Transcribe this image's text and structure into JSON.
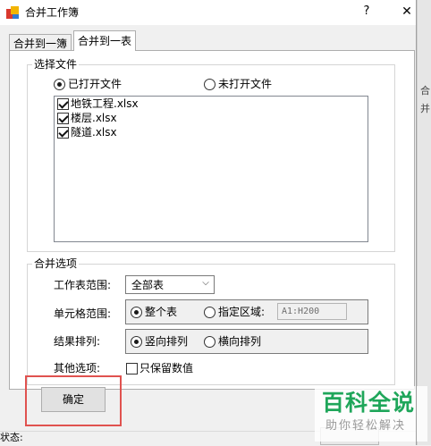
{
  "window": {
    "title": "合并工作簿",
    "help_label": "?",
    "close_label": "✕"
  },
  "tabs": [
    {
      "label": "合并到一簿",
      "selected": false
    },
    {
      "label": "合并到一表",
      "selected": true
    }
  ],
  "file_group": {
    "legend": "选择文件",
    "radio_opened": {
      "label": "已打开文件",
      "checked": true
    },
    "radio_unopened": {
      "label": "未打开文件",
      "checked": false
    },
    "files": [
      {
        "label": "地铁工程.xlsx",
        "checked": true
      },
      {
        "label": "楼层.xlsx",
        "checked": true
      },
      {
        "label": "隧道.xlsx",
        "checked": true
      }
    ]
  },
  "merge_group": {
    "legend": "合并选项",
    "sheet_range": {
      "label": "工作表范围:",
      "value": "全部表",
      "arrow_icon": "chevron-down-icon"
    },
    "cell_range": {
      "label": "单元格范围:",
      "opt_whole": {
        "label": "整个表",
        "checked": true
      },
      "opt_specified": {
        "label": "指定区域:",
        "checked": false
      },
      "range_value": "A1:H200"
    },
    "result_order": {
      "label": "结果排列:",
      "opt_vertical": {
        "label": "竖向排列",
        "checked": true
      },
      "opt_horizontal": {
        "label": "横向排列",
        "checked": false
      }
    },
    "other_options": {
      "label": "其他选项:",
      "values_only": {
        "label": "只保留数值",
        "checked": false
      }
    }
  },
  "ok_button": {
    "label": "确定"
  },
  "status": {
    "label": "状态:"
  },
  "background_text": {
    "right_chars": "合 并"
  },
  "watermark": {
    "main": "百科全说",
    "sub": "助你轻松解决"
  },
  "colors": {
    "highlight": "#e0524f",
    "watermark_green": "#1fa65a"
  }
}
